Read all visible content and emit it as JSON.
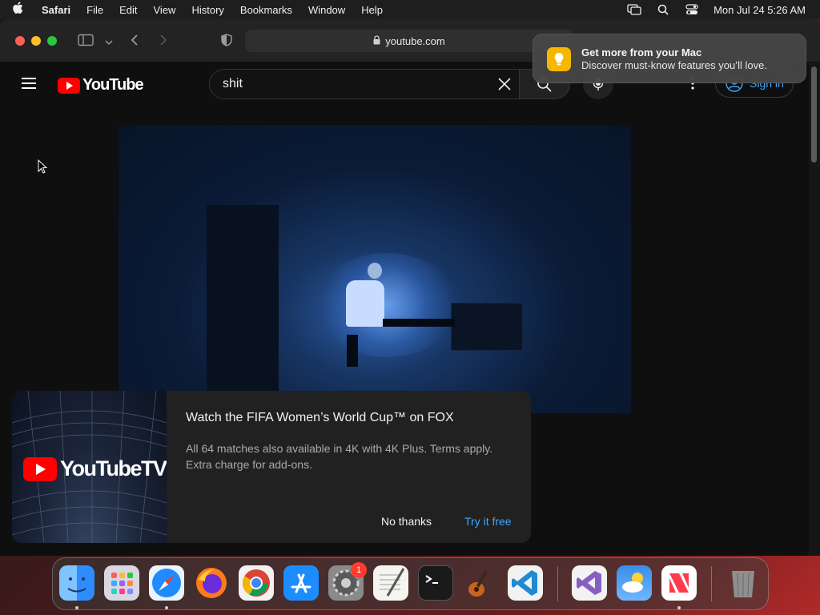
{
  "menubar": {
    "app_name": "Safari",
    "items": [
      "File",
      "Edit",
      "View",
      "History",
      "Bookmarks",
      "Window",
      "Help"
    ],
    "clock": "Mon Jul 24  5:26 AM"
  },
  "browser": {
    "url": "youtube.com"
  },
  "youtube": {
    "logo_text": "YouTube",
    "search_value": "shit",
    "sign_in_label": "Sign in"
  },
  "promo": {
    "logo_text": "YouTubeTV",
    "title": "Watch the FIFA Women’s World Cup™ on FOX",
    "body": "All 64 matches also available in 4K with 4K Plus. Terms apply. Extra charge for add-ons.",
    "dismiss_label": "No thanks",
    "cta_label": "Try it free"
  },
  "notification": {
    "title": "Get more from your Mac",
    "body": "Discover must-know features you’ll love."
  },
  "dock": {
    "apps": [
      "Finder",
      "Launchpad",
      "Safari",
      "Firefox",
      "Chrome",
      "App Store",
      "System Settings",
      "TextEdit",
      "Terminal",
      "GarageBand",
      "Visual Studio Code",
      "Visual Studio",
      "Weather",
      "News",
      "Trash"
    ],
    "settings_badge": "1"
  }
}
